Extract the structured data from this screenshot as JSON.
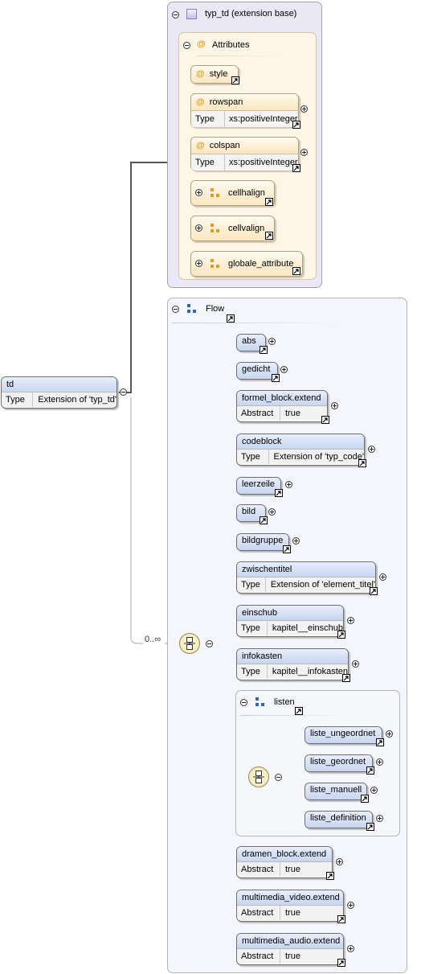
{
  "root": {
    "name": "td",
    "type_key": "Type",
    "type_value": "Extension of 'typ_td'"
  },
  "base": {
    "title": "typ_td (extension base)"
  },
  "attributes": {
    "title": "Attributes",
    "items": [
      {
        "name": "style"
      },
      {
        "name": "rowspan",
        "type_key": "Type",
        "type_value": "xs:positiveInteger"
      },
      {
        "name": "colspan",
        "type_key": "Type",
        "type_value": "xs:positiveInteger"
      }
    ],
    "groups": [
      {
        "name": "cellhalign"
      },
      {
        "name": "cellvalign"
      },
      {
        "name": "globale_attribute"
      }
    ]
  },
  "flow": {
    "title": "Flow",
    "cardinality": "0..∞"
  },
  "elements": [
    {
      "name": "abs"
    },
    {
      "name": "gedicht"
    },
    {
      "name": "formel_block.extend",
      "key": "Abstract",
      "value": "true"
    },
    {
      "name": "codeblock",
      "key": "Type",
      "value": "Extension of 'typ_code'"
    },
    {
      "name": "leerzeile"
    },
    {
      "name": "bild"
    },
    {
      "name": "bildgruppe"
    },
    {
      "name": "zwischentitel",
      "key": "Type",
      "value": "Extension of 'element_titel'"
    },
    {
      "name": "einschub",
      "key": "Type",
      "value": "kapitel__einschub"
    },
    {
      "name": "infokasten",
      "key": "Type",
      "value": "kapitel__infokasten"
    },
    {
      "name": "dramen_block.extend",
      "key": "Abstract",
      "value": "true"
    },
    {
      "name": "multimedia_video.extend",
      "key": "Abstract",
      "value": "true"
    },
    {
      "name": "multimedia_audio.extend",
      "key": "Abstract",
      "value": "true"
    }
  ],
  "listen": {
    "title": "listen",
    "items": [
      {
        "name": "liste_ungeordnet"
      },
      {
        "name": "liste_geordnet"
      },
      {
        "name": "liste_manuell"
      },
      {
        "name": "liste_definition"
      }
    ]
  },
  "icons": {
    "collapse": "collapse-icon",
    "expand": "expand-icon",
    "link": "link-arrow-icon",
    "sequence": "sequence-icon",
    "complex-type": "complex-type-icon",
    "attribute-group": "attribute-group-icon",
    "group": "group-icon"
  },
  "colors": {
    "element_header": "#c8d6f2",
    "attribute_header": "#fbe6bf",
    "base_panel": "#ebe8f5",
    "attributes_panel": "#fdf6e7",
    "sequence": "#f2e6a8"
  }
}
